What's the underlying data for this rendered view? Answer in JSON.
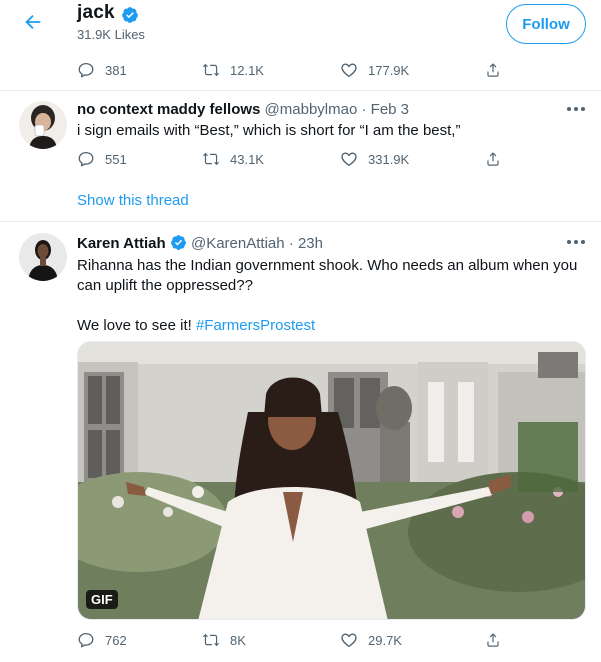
{
  "header": {
    "title": "jack",
    "subtitle": "31.9K Likes",
    "follow_label": "Follow"
  },
  "top_tweet_actions": {
    "replies": "381",
    "retweets": "12.1K",
    "likes": "177.9K"
  },
  "tweets": [
    {
      "author": "no context maddy fellows",
      "handle": "@mabbylmao",
      "separator": "·",
      "time": "Feb 3",
      "text": "i sign emails with “Best,” which is short for “I am the best,”",
      "replies": "551",
      "retweets": "43.1K",
      "likes": "331.9K",
      "show_thread": "Show this thread"
    },
    {
      "author": "Karen Attiah",
      "handle": "@KarenAttiah",
      "separator": "·",
      "time": "23h",
      "text_line1": "Rihanna has the Indian government shook. Who needs an album when you",
      "text_line2": "can uplift the oppressed??",
      "text_line3": "We love to see it!",
      "hashtag": "#FarmersProstest",
      "media_badge": "GIF",
      "replies": "762",
      "retweets": "8K",
      "likes": "29.7K"
    }
  ],
  "colors": {
    "accent": "#1d9bf0",
    "muted": "#536471",
    "text": "#0f1419",
    "divider": "#e6ecf0"
  },
  "icons": [
    "back-arrow-icon",
    "verified-badge-icon",
    "reply-icon",
    "retweet-icon",
    "like-icon",
    "share-icon",
    "more-icon"
  ]
}
